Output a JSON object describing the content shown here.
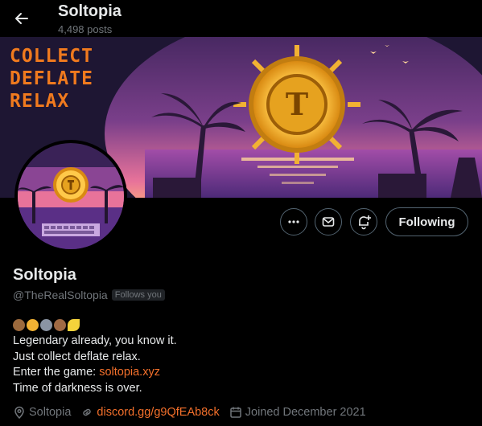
{
  "header": {
    "title": "Soltopia",
    "post_count": "4,498 posts"
  },
  "banner": {
    "lines": [
      "COLLECT",
      "DEFLATE",
      "RELAX"
    ],
    "coin_letter": "T"
  },
  "actions": {
    "following_label": "Following"
  },
  "profile": {
    "name": "Soltopia",
    "handle": "@TheRealSoltopia",
    "follows_you": "Follows you",
    "bio": {
      "line1": "Legendary already, you know it.",
      "line2": "Just collect deflate relax.",
      "line3_prefix": "Enter the game: ",
      "line3_link": "soltopia.xyz",
      "line4": "Time of darkness is over."
    },
    "location": "Soltopia",
    "website": "discord.gg/g9QfEAb8ck",
    "joined": "Joined December 2021"
  },
  "emoji_icons": [
    "bear-icon",
    "cat-icon",
    "wolf-icon",
    "monkey-icon",
    "banana-icon"
  ],
  "colors": {
    "accent_orange": "#f4702b",
    "muted_text": "#71767b",
    "border": "#536471"
  }
}
